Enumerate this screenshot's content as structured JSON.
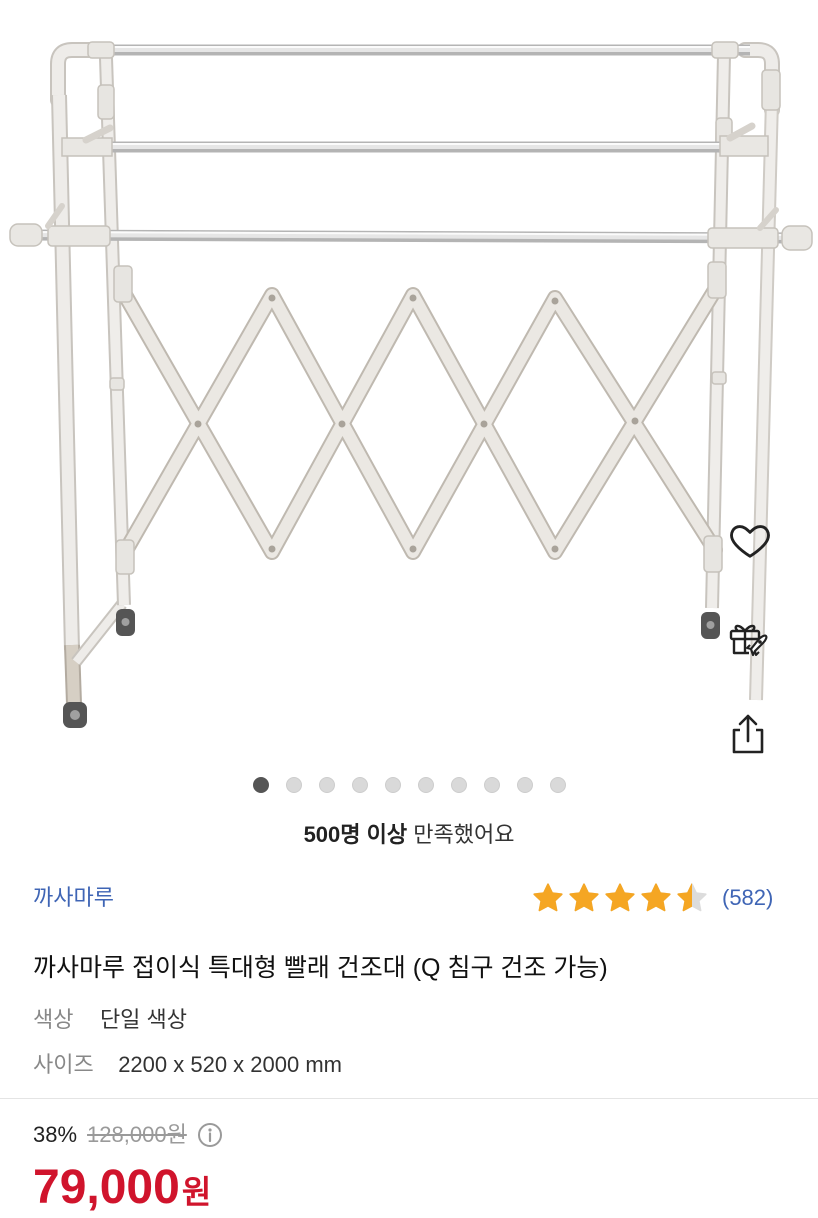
{
  "carousel": {
    "total": 10,
    "active_index": 0
  },
  "floating_actions": {
    "like_icon": "heart-icon",
    "gift_icon": "gift-icon",
    "share_icon": "share-icon"
  },
  "satisfaction": {
    "highlight": "500명 이상",
    "text": "만족했어요"
  },
  "seller": {
    "brand": "까사마루"
  },
  "rating": {
    "value": 4.5,
    "max": 5,
    "count_label": "(582)"
  },
  "product": {
    "title": "까사마루 접이식 특대형 빨래 건조대 (Q 침구 건조 가능)"
  },
  "options": [
    {
      "label": "색상",
      "value": "단일 색상"
    },
    {
      "label": "사이즈",
      "value": "2200 x 520 x 2000 mm"
    }
  ],
  "price": {
    "discount_rate": "38%",
    "original_price": "128,000원",
    "sale_amount": "79,000",
    "sale_currency": "원",
    "info_icon": "info-icon"
  },
  "colors": {
    "brand_blue": "#3f65b5",
    "star": "#f5a623",
    "star_empty": "#dcdcdc",
    "sale_red": "#d0142c",
    "dot_active": "#555555",
    "dot_inactive": "#d9d9d9"
  }
}
